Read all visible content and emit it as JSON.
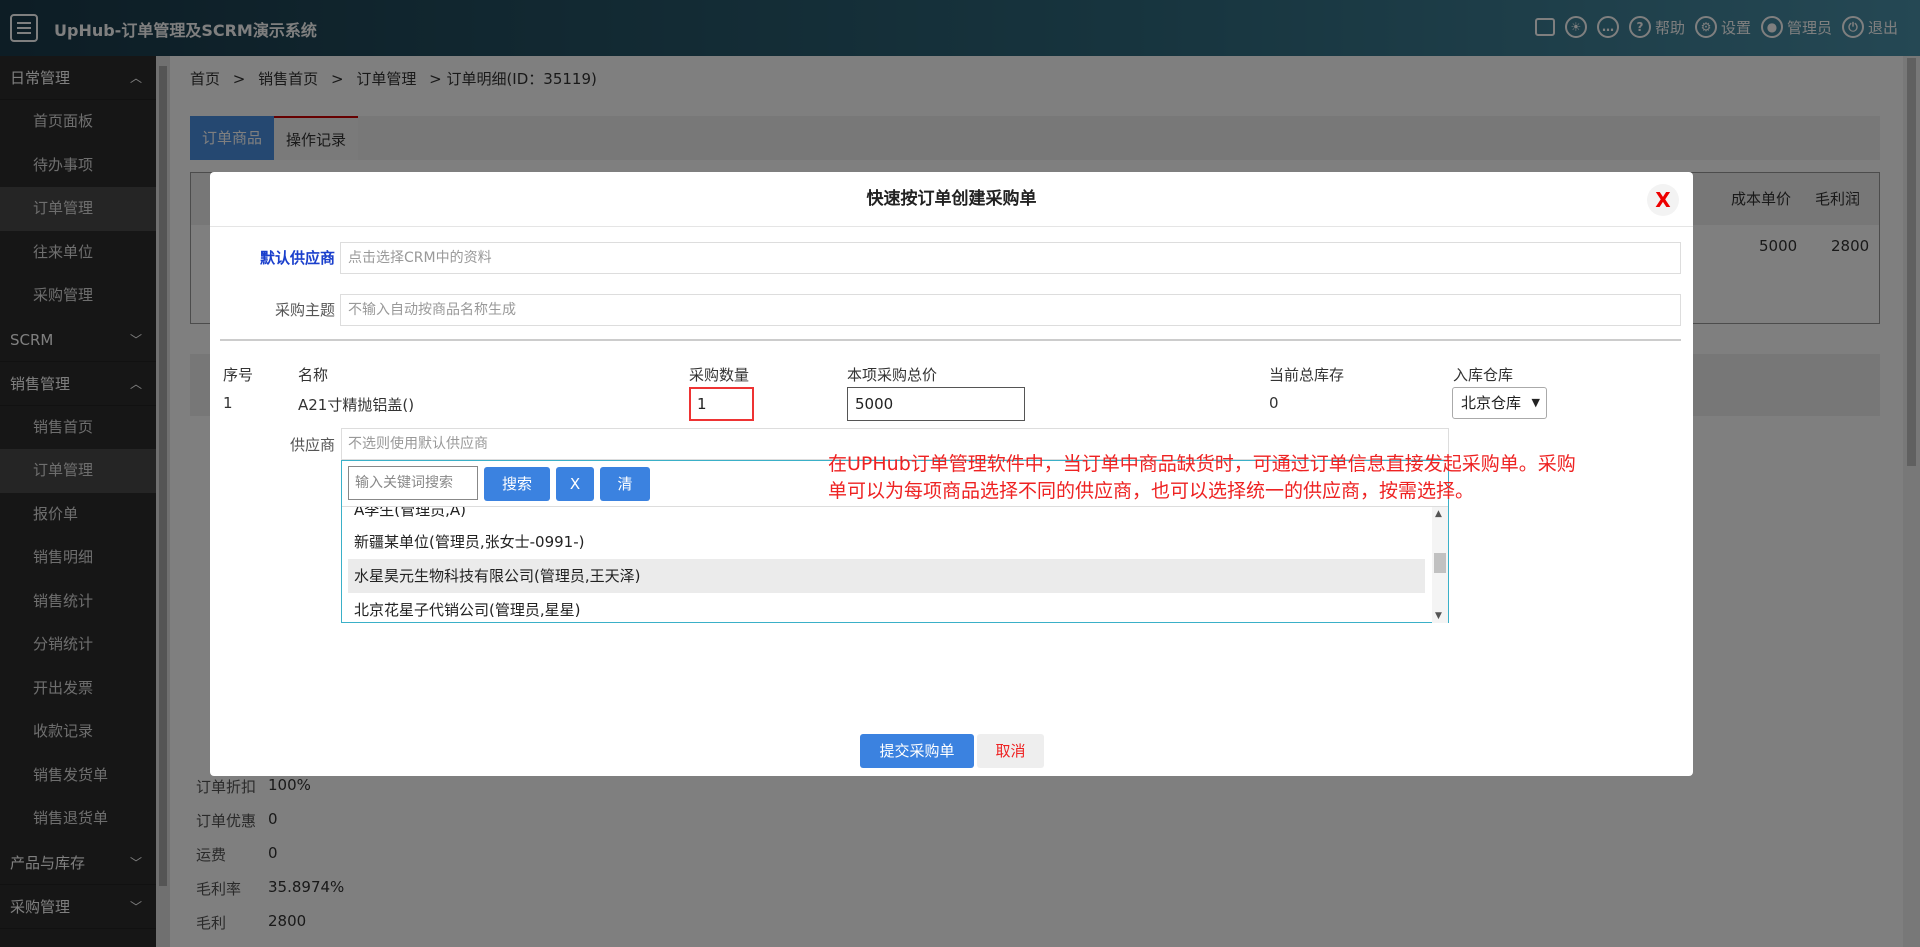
{
  "app": {
    "title": "UpHub-订单管理及SCRM演示系统",
    "toolbar": {
      "help": "帮助",
      "settings": "设置",
      "admin": "管理员",
      "logout": "退出"
    }
  },
  "sidebar": {
    "groups": [
      {
        "label": "日常管理",
        "expanded": true,
        "items": [
          "首页面板",
          "待办事项",
          "订单管理",
          "往来单位",
          "采购管理"
        ]
      },
      {
        "label": "SCRM",
        "expanded": false
      },
      {
        "label": "销售管理",
        "expanded": true,
        "items": [
          "销售首页",
          "订单管理",
          "报价单",
          "销售明细",
          "销售统计",
          "分销统计",
          "开出发票",
          "收款记录",
          "销售发货单",
          "销售退货单"
        ]
      },
      {
        "label": "产品与库存",
        "expanded": false
      },
      {
        "label": "采购管理",
        "expanded": false
      }
    ]
  },
  "breadcrumb": [
    "首页",
    ">",
    "销售首页",
    ">",
    "订单管理",
    "> 订单明细(ID：35119)"
  ],
  "tabs": [
    "订单商品",
    "操作记录"
  ],
  "bg_table": {
    "headers": [
      "成本单价",
      "毛利润"
    ],
    "values": [
      "5000",
      "2800"
    ]
  },
  "bg_info": [
    {
      "label": "订单折扣",
      "value": "100%"
    },
    {
      "label": "订单优惠",
      "value": "0"
    },
    {
      "label": "运费",
      "value": "0"
    },
    {
      "label": "毛利率",
      "value": "35.8974%"
    },
    {
      "label": "毛利",
      "value": "2800"
    }
  ],
  "modal": {
    "title": "快速按订单创建采购单",
    "close": "X",
    "default_supplier_label": "默认供应商",
    "default_supplier_placeholder": "点击选择CRM中的资料",
    "subject_label": "采购主题",
    "subject_placeholder": "不输入自动按商品名称生成",
    "columns": [
      "序号",
      "名称",
      "采购数量",
      "本项采购总价",
      "当前总库存",
      "入库仓库"
    ],
    "row": {
      "no": "1",
      "name": "A21寸精抛铝盖()",
      "qty": "1",
      "total": "5000",
      "stock": "0",
      "warehouse": "北京仓库"
    },
    "supplier_label": "供应商",
    "supplier_placeholder": "不选则使用默认供应商",
    "search_placeholder": "输入关键词搜索",
    "search_btn": "搜索",
    "x_btn": "X",
    "clear_btn": "清",
    "options": [
      "A李生(管理员,A)",
      "新疆某单位(管理员,张女士-0991-)",
      "水星昊元生物科技有限公司(管理员,王天泽)",
      "北京花星子代销公司(管理员,星星)"
    ],
    "note": "在UPHub订单管理软件中，当订单中商品缺货时，可通过订单信息直接发起采购单。采购单可以为每项商品选择不同的供应商，也可以选择统一的供应商，按需选择。",
    "submit": "提交采购单",
    "cancel": "取消"
  }
}
